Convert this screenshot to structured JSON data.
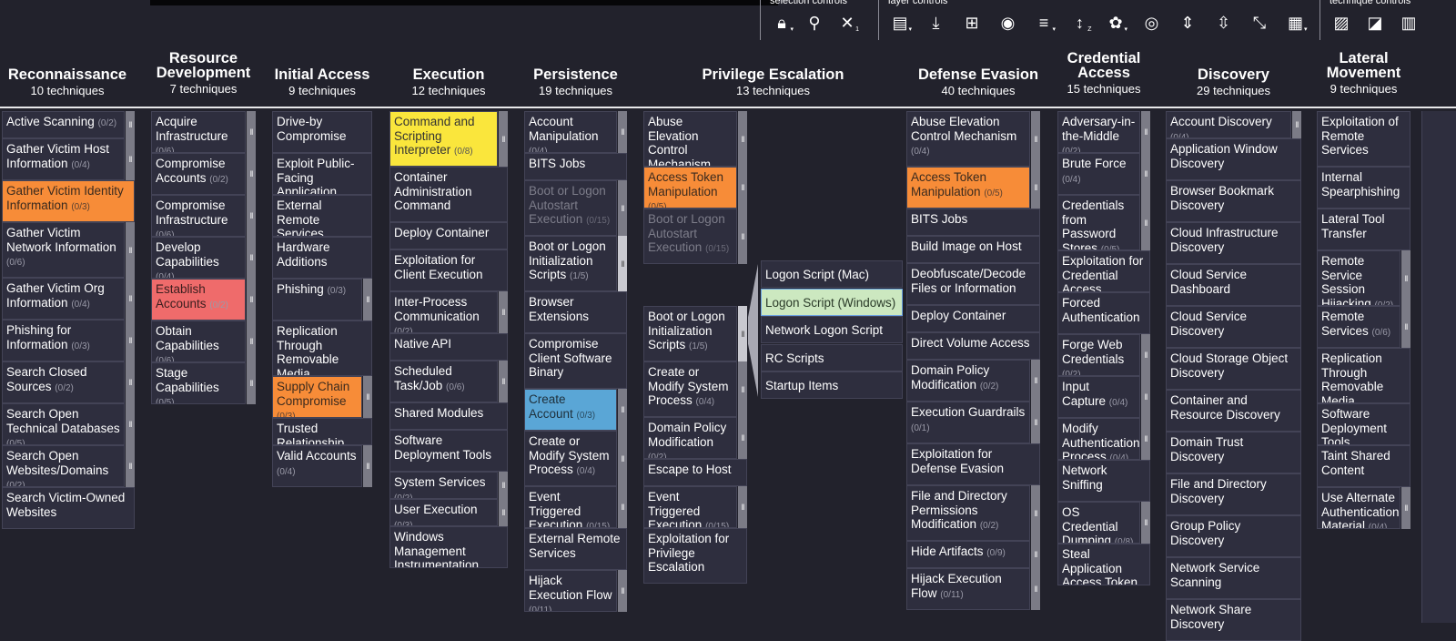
{
  "toolbar": {
    "groups": [
      {
        "label": "selection controls",
        "buttons": [
          {
            "icon": "lock-icon",
            "glyph": "🔒︎",
            "sub": "▾"
          },
          {
            "icon": "search-icon",
            "glyph": "⚲",
            "sub": ""
          },
          {
            "icon": "deselect-icon",
            "glyph": "✕",
            "sub": "1"
          }
        ]
      },
      {
        "label": "layer controls",
        "buttons": [
          {
            "icon": "layer-info-icon",
            "glyph": "▤",
            "sub": "▾"
          },
          {
            "icon": "download-icon",
            "glyph": "⤓",
            "sub": ""
          },
          {
            "icon": "export-excel-icon",
            "glyph": "⊞",
            "sub": ""
          },
          {
            "icon": "camera-icon",
            "glyph": "◉",
            "sub": ""
          },
          {
            "icon": "filter-icon",
            "glyph": "≡",
            "sub": "▾"
          },
          {
            "icon": "sort-icon",
            "glyph": "↕",
            "sub": "Z"
          },
          {
            "icon": "color-setup-icon",
            "glyph": "✿",
            "sub": "▾"
          },
          {
            "icon": "visibility-icon",
            "glyph": "◎",
            "sub": ""
          },
          {
            "icon": "expand-icon",
            "glyph": "⇕",
            "sub": ""
          },
          {
            "icon": "expand-sub-icon",
            "glyph": "⇳",
            "sub": ""
          },
          {
            "icon": "collapse-icon",
            "glyph": "⤡",
            "sub": ""
          },
          {
            "icon": "layout-icon",
            "glyph": "▦",
            "sub": "▾"
          }
        ]
      },
      {
        "label": "technique controls",
        "buttons": [
          {
            "icon": "disable-pattern-icon",
            "glyph": "▨",
            "sub": ""
          },
          {
            "icon": "fill-color-icon",
            "glyph": "◪",
            "sub": ""
          },
          {
            "icon": "score-chart-icon",
            "glyph": "▥",
            "sub": ""
          }
        ]
      }
    ]
  },
  "tactics": [
    {
      "name": "Reconnaissance",
      "count": "10 techniques",
      "techniques": [
        {
          "label": "Active Scanning",
          "sub": "(0/2)"
        },
        {
          "label": "Gather Victim Host Information",
          "sub": "(0/4)"
        },
        {
          "label": "Gather Victim Identity Information",
          "sub": "(0/3)",
          "color": "orange"
        },
        {
          "label": "Gather Victim Network Information",
          "sub": "(0/6)"
        },
        {
          "label": "Gather Victim Org Information",
          "sub": "(0/4)"
        },
        {
          "label": "Phishing for Information",
          "sub": "(0/3)"
        },
        {
          "label": "Search Closed Sources",
          "sub": "(0/2)"
        },
        {
          "label": "Search Open Technical Databases",
          "sub": "(0/5)"
        },
        {
          "label": "Search Open Websites/Domains",
          "sub": "(0/2)"
        },
        {
          "label": "Search Victim-Owned Websites"
        }
      ]
    },
    {
      "name": "Resource Development",
      "count": "7 techniques",
      "techniques": [
        {
          "label": "Acquire Infrastructure",
          "sub": "(0/6)"
        },
        {
          "label": "Compromise Accounts",
          "sub": "(0/2)"
        },
        {
          "label": "Compromise Infrastructure",
          "sub": "(0/6)"
        },
        {
          "label": "Develop Capabilities",
          "sub": "(0/4)"
        },
        {
          "label": "Establish Accounts",
          "sub": "(0/2)",
          "color": "red"
        },
        {
          "label": "Obtain Capabilities",
          "sub": "(0/6)"
        },
        {
          "label": "Stage Capabilities",
          "sub": "(0/5)"
        }
      ]
    },
    {
      "name": "Initial Access",
      "count": "9 techniques",
      "techniques": [
        {
          "label": "Drive-by Compromise"
        },
        {
          "label": "Exploit Public-Facing Application"
        },
        {
          "label": "External Remote Services"
        },
        {
          "label": "Hardware Additions"
        },
        {
          "label": "Phishing",
          "sub": "(0/3)"
        },
        {
          "label": "Replication Through Removable Media"
        },
        {
          "label": "Supply Chain Compromise",
          "sub": "(0/3)",
          "color": "orange"
        },
        {
          "label": "Trusted Relationship"
        },
        {
          "label": "Valid Accounts",
          "sub": "(0/4)"
        }
      ]
    },
    {
      "name": "Execution",
      "count": "12 techniques",
      "techniques": [
        {
          "label": "Command and Scripting Interpreter",
          "sub": "(0/8)",
          "color": "yellow"
        },
        {
          "label": "Container Administration Command"
        },
        {
          "label": "Deploy Container"
        },
        {
          "label": "Exploitation for Client Execution"
        },
        {
          "label": "Inter-Process Communication",
          "sub": "(0/2)"
        },
        {
          "label": "Native API"
        },
        {
          "label": "Scheduled Task/Job",
          "sub": "(0/6)"
        },
        {
          "label": "Shared Modules"
        },
        {
          "label": "Software Deployment Tools"
        },
        {
          "label": "System Services",
          "sub": "(0/2)"
        },
        {
          "label": "User Execution",
          "sub": "(0/3)"
        },
        {
          "label": "Windows Management Instrumentation"
        }
      ]
    },
    {
      "name": "Persistence",
      "count": "19 techniques",
      "techniques": [
        {
          "label": "Account Manipulation",
          "sub": "(0/4)"
        },
        {
          "label": "BITS Jobs"
        },
        {
          "label": "Boot or Logon Autostart Execution",
          "sub": "(0/15)",
          "color": "gray"
        },
        {
          "label": "Boot or Logon Initialization Scripts",
          "sub": "(1/5)"
        },
        {
          "label": "Browser Extensions"
        },
        {
          "label": "Compromise Client Software Binary"
        },
        {
          "label": "Create Account",
          "sub": "(0/3)",
          "color": "blue"
        },
        {
          "label": "Create or Modify System Process",
          "sub": "(0/4)"
        },
        {
          "label": "Event Triggered Execution",
          "sub": "(0/15)"
        },
        {
          "label": "External Remote Services"
        },
        {
          "label": "Hijack Execution Flow",
          "sub": "(0/11)"
        }
      ]
    },
    {
      "name": "Privilege Escalation",
      "count": "13 techniques",
      "techniques": [
        {
          "label": "Abuse Elevation Control Mechanism",
          "sub": "(0/4)"
        },
        {
          "label": "Access Token Manipulation",
          "sub": "(0/5)",
          "color": "orange"
        },
        {
          "label": "Boot or Logon Autostart Execution",
          "sub": "(0/15)",
          "color": "gray"
        },
        {
          "label": "Boot or Logon Initialization Scripts",
          "sub": "(1/5)"
        },
        {
          "label": "Create or Modify System Process",
          "sub": "(0/4)"
        },
        {
          "label": "Domain Policy Modification",
          "sub": "(0/2)"
        },
        {
          "label": "Escape to Host"
        },
        {
          "label": "Event Triggered Execution",
          "sub": "(0/15)"
        },
        {
          "label": "Exploitation for Privilege Escalation"
        }
      ],
      "subtechniques": [
        {
          "label": "Logon Script (Mac)"
        },
        {
          "label": "Logon Script (Windows)",
          "color": "green"
        },
        {
          "label": "Network Logon Script"
        },
        {
          "label": "RC Scripts"
        },
        {
          "label": "Startup Items"
        }
      ]
    },
    {
      "name": "Defense Evasion",
      "count": "40 techniques",
      "techniques": [
        {
          "label": "Abuse Elevation Control Mechanism",
          "sub": "(0/4)"
        },
        {
          "label": "Access Token Manipulation",
          "sub": "(0/5)",
          "color": "orange"
        },
        {
          "label": "BITS Jobs"
        },
        {
          "label": "Build Image on Host"
        },
        {
          "label": "Deobfuscate/Decode Files or Information"
        },
        {
          "label": "Deploy Container"
        },
        {
          "label": "Direct Volume Access"
        },
        {
          "label": "Domain Policy Modification",
          "sub": "(0/2)"
        },
        {
          "label": "Execution Guardrails",
          "sub": "(0/1)"
        },
        {
          "label": "Exploitation for Defense Evasion"
        },
        {
          "label": "File and Directory Permissions Modification",
          "sub": "(0/2)"
        },
        {
          "label": "Hide Artifacts",
          "sub": "(0/9)"
        },
        {
          "label": "Hijack Execution Flow",
          "sub": "(0/11)"
        }
      ]
    },
    {
      "name": "Credential Access",
      "count": "15 techniques",
      "techniques": [
        {
          "label": "Adversary-in-the-Middle",
          "sub": "(0/2)"
        },
        {
          "label": "Brute Force",
          "sub": "(0/4)"
        },
        {
          "label": "Credentials from Password Stores",
          "sub": "(0/5)"
        },
        {
          "label": "Exploitation for Credential Access"
        },
        {
          "label": "Forced Authentication"
        },
        {
          "label": "Forge Web Credentials",
          "sub": "(0/2)"
        },
        {
          "label": "Input Capture",
          "sub": "(0/4)"
        },
        {
          "label": "Modify Authentication Process",
          "sub": "(0/4)"
        },
        {
          "label": "Network Sniffing"
        },
        {
          "label": "OS Credential Dumping",
          "sub": "(0/8)"
        },
        {
          "label": "Steal Application Access Token"
        }
      ]
    },
    {
      "name": "Discovery",
      "count": "29 techniques",
      "techniques": [
        {
          "label": "Account Discovery",
          "sub": "(0/4)"
        },
        {
          "label": "Application Window Discovery"
        },
        {
          "label": "Browser Bookmark Discovery"
        },
        {
          "label": "Cloud Infrastructure Discovery"
        },
        {
          "label": "Cloud Service Dashboard"
        },
        {
          "label": "Cloud Service Discovery"
        },
        {
          "label": "Cloud Storage Object Discovery"
        },
        {
          "label": "Container and Resource Discovery"
        },
        {
          "label": "Domain Trust Discovery"
        },
        {
          "label": "File and Directory Discovery"
        },
        {
          "label": "Group Policy Discovery"
        },
        {
          "label": "Network Service Scanning"
        },
        {
          "label": "Network Share Discovery"
        }
      ]
    },
    {
      "name": "Lateral Movement",
      "count": "9 techniques",
      "techniques": [
        {
          "label": "Exploitation of Remote Services"
        },
        {
          "label": "Internal Spearphishing"
        },
        {
          "label": "Lateral Tool Transfer"
        },
        {
          "label": "Remote Service Session Hijacking",
          "sub": "(0/2)"
        },
        {
          "label": "Remote Services",
          "sub": "(0/6)"
        },
        {
          "label": "Replication Through Removable Media"
        },
        {
          "label": "Software Deployment Tools"
        },
        {
          "label": "Taint Shared Content"
        },
        {
          "label": "Use Alternate Authentication Material",
          "sub": "(0/4)"
        }
      ]
    }
  ]
}
